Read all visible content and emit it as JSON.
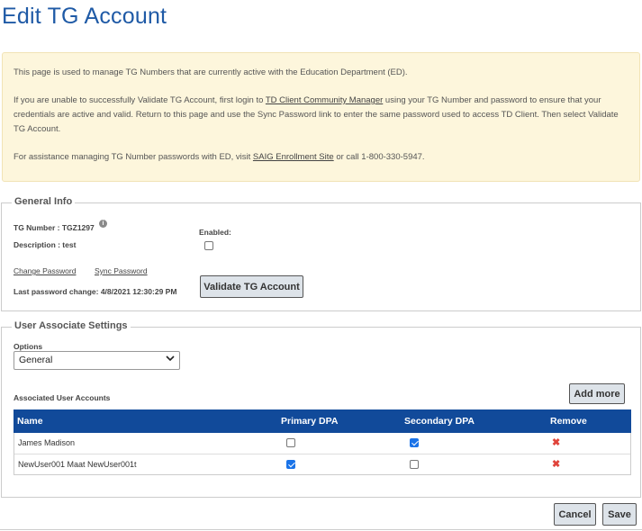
{
  "page": {
    "title": "Edit TG Account"
  },
  "info": {
    "line1": "This page is used to manage TG Numbers that are currently active with the Education Department (ED).",
    "line2_pre": "If you are unable to successfully Validate TG Account, first login to ",
    "line2_link": "TD Client Community Manager",
    "line2_post": " using your TG Number and password to ensure that your credentials are active and valid. Return to this page and use the Sync Password link to enter the same password used to access TD Client. Then select Validate TG Account.",
    "line3_pre": "For assistance managing TG Number passwords with ED, visit ",
    "line3_link": "SAIG Enrollment Site",
    "line3_post": " or call 1-800-330-5947."
  },
  "general": {
    "legend": "General Info",
    "tg_number": "TG Number : TGZ1297",
    "info_icon": "i",
    "description": "Description : test",
    "enabled_label": "Enabled:",
    "enabled": false,
    "change_password": "Change Password",
    "sync_password": "Sync Password",
    "last_change": "Last password change: 4/8/2021 12:30:29 PM",
    "validate_button": "Validate TG Account"
  },
  "users": {
    "legend": "User Associate Settings",
    "options_label": "Options",
    "options_selected": "General",
    "associated_label": "Associated User Accounts",
    "add_more": "Add more",
    "columns": [
      "Name",
      "Primary DPA",
      "Secondary DPA",
      "Remove"
    ],
    "rows": [
      {
        "name": "James Madison",
        "primary": false,
        "secondary": true
      },
      {
        "name": "NewUser001 Maat NewUser001t",
        "primary": true,
        "secondary": false
      }
    ]
  },
  "actions": {
    "cancel": "Cancel",
    "save": "Save"
  },
  "icons": {
    "remove": "✖",
    "chevron": "⌄",
    "info": "info-icon"
  },
  "colors": {
    "title": "#1f5aa6",
    "table_header": "#114a9a",
    "info_bg": "#fdf6dc",
    "remove": "#e0443b"
  }
}
